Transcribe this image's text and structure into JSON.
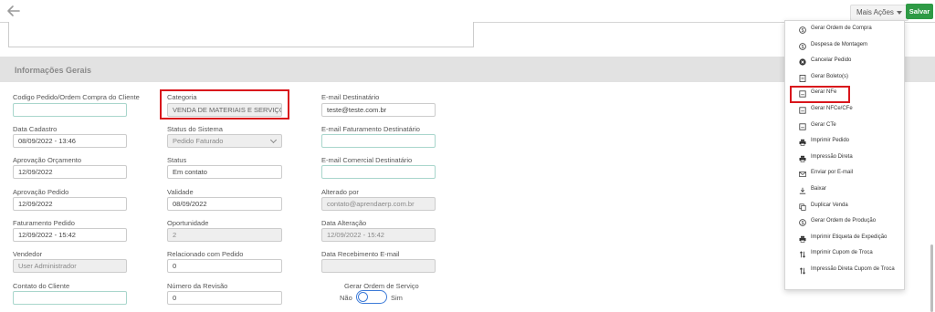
{
  "topbar": {
    "mais_acoes_label": "Mais Ações",
    "salvar_label": "Salvar"
  },
  "section": {
    "title": "Informações Gerais"
  },
  "fields": {
    "codigo_pedido": {
      "label": "Codigo Pedido/Ordem Compra do Cliente",
      "value": ""
    },
    "categoria": {
      "label": "Categoria",
      "value": "VENDA DE MATERIAIS E SERVIÇOS"
    },
    "email_destinatario": {
      "label": "E-mail Destinatário",
      "value": "teste@teste.com.br"
    },
    "data_cadastro": {
      "label": "Data Cadastro",
      "value": "08/09/2022 - 13:46"
    },
    "status_sistema": {
      "label": "Status do Sistema",
      "value": "Pedido Faturado"
    },
    "email_faturamento": {
      "label": "E-mail Faturamento Destinatário",
      "value": ""
    },
    "aprovacao_orcamento": {
      "label": "Aprovação Orçamento",
      "value": "12/09/2022"
    },
    "status": {
      "label": "Status",
      "value": "Em contato"
    },
    "email_comercial": {
      "label": "E-mail Comercial Destinatário",
      "value": ""
    },
    "aprovacao_pedido": {
      "label": "Aprovação Pedido",
      "value": "12/09/2022"
    },
    "validade": {
      "label": "Validade",
      "value": "08/09/2022"
    },
    "alterado_por": {
      "label": "Alterado por",
      "value": "contato@aprendaerp.com.br"
    },
    "faturamento_pedido": {
      "label": "Faturamento Pedido",
      "value": "12/09/2022 - 15:42"
    },
    "oportunidade": {
      "label": "Oportunidade",
      "value": "2"
    },
    "data_alteracao": {
      "label": "Data Alteração",
      "value": "12/09/2022 - 15:42"
    },
    "vendedor": {
      "label": "Vendedor",
      "value": "User Administrador"
    },
    "relacionado_pedido": {
      "label": "Relacionado com Pedido",
      "value": "0"
    },
    "data_recebimento_email": {
      "label": "Data Recebimento E-mail",
      "value": ""
    },
    "contato_cliente": {
      "label": "Contato do Cliente",
      "value": ""
    },
    "numero_revisao": {
      "label": "Número da Revisão",
      "value": "0"
    }
  },
  "gerar_os": {
    "label": "Gerar Ordem de Serviço",
    "no": "Não",
    "yes": "Sim"
  },
  "menu": {
    "items": [
      {
        "label": "Gerar Ordem de Compra",
        "icon": "dollar-circle-icon"
      },
      {
        "label": "Despesa de Montagem",
        "icon": "dollar-circle-icon"
      },
      {
        "label": "Cancelar Pedido",
        "icon": "x-circle-icon"
      },
      {
        "label": "Gerar Boleto(s)",
        "icon": "document-icon"
      },
      {
        "label": "Gerar NFe",
        "icon": "document-xml-icon"
      },
      {
        "label": "Gerar NFCe/CFe",
        "icon": "document-xml-icon"
      },
      {
        "label": "Gerar CTe",
        "icon": "document-xml-icon"
      },
      {
        "label": "Imprimir Pedido",
        "icon": "printer-icon"
      },
      {
        "label": "Impressão Direta",
        "icon": "printer-icon"
      },
      {
        "label": "Enviar por E-mail",
        "icon": "envelope-icon"
      },
      {
        "label": "Baixar",
        "icon": "download-icon"
      },
      {
        "label": "Duplicar Venda",
        "icon": "copy-icon"
      },
      {
        "label": "Gerar Ordem de Produção",
        "icon": "dollar-circle-icon"
      },
      {
        "label": "Imprimir Etiqueta de Expedição",
        "icon": "printer-icon"
      },
      {
        "label": "Imprimir Cupom de Troca",
        "icon": "swap-arrows-icon"
      },
      {
        "label": "Impressão Direta Cupom de Troca",
        "icon": "swap-arrows-icon"
      }
    ]
  },
  "colors": {
    "highlight": "#d9161c",
    "accent_green": "#2e9a45",
    "toggle_blue": "#3d7bd8"
  }
}
